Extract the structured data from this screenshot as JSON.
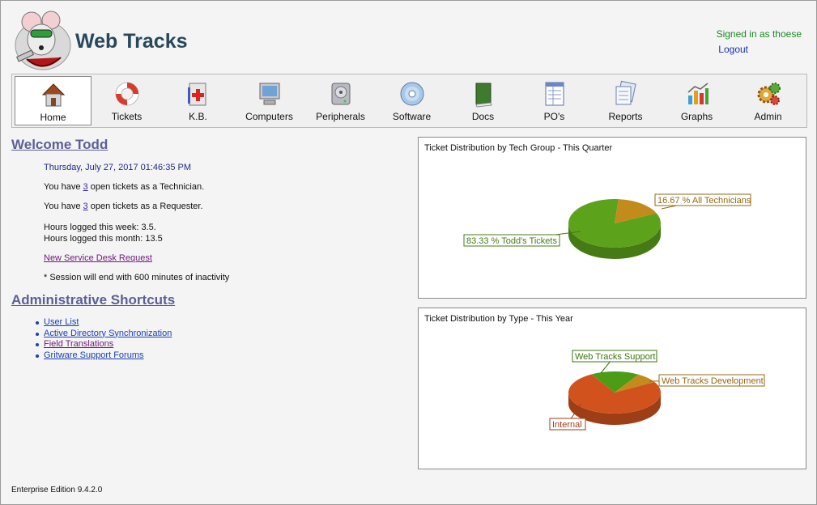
{
  "header": {
    "app_title": "Web Tracks",
    "signed_in": "Signed in as thoese",
    "logout": "Logout"
  },
  "nav": [
    {
      "label": "Home",
      "icon": "home-icon",
      "active": true
    },
    {
      "label": "Tickets",
      "icon": "lifebuoy-icon"
    },
    {
      "label": "K.B.",
      "icon": "first-aid-kit-icon"
    },
    {
      "label": "Computers",
      "icon": "monitor-icon"
    },
    {
      "label": "Peripherals",
      "icon": "hard-drive-icon"
    },
    {
      "label": "Software",
      "icon": "cd-icon"
    },
    {
      "label": "Docs",
      "icon": "book-icon"
    },
    {
      "label": "PO's",
      "icon": "form-icon"
    },
    {
      "label": "Reports",
      "icon": "reports-icon"
    },
    {
      "label": "Graphs",
      "icon": "bar-graph-icon"
    },
    {
      "label": "Admin",
      "icon": "gears-icon"
    }
  ],
  "welcome": {
    "title": "Welcome Todd",
    "date": "Thursday, July 27, 2017 01:46:35 PM",
    "tech_prefix": "You have ",
    "tech_count": "3",
    "tech_suffix": " open tickets as a Technician.",
    "req_prefix": "You have ",
    "req_count": "3",
    "req_suffix": " open tickets as a Requester.",
    "hours_week": "Hours logged this week: 3.5.",
    "hours_month": "Hours logged this month: 13.5",
    "new_request": "New Service Desk Request",
    "session_note": "* Session will end with 600 minutes of inactivity"
  },
  "shortcuts": {
    "title": "Administrative Shortcuts",
    "items": [
      {
        "label": "User List"
      },
      {
        "label": "Active Directory Synchronization"
      },
      {
        "label": "Field Translations"
      },
      {
        "label": "Gritware Support Forums"
      }
    ]
  },
  "chart_data": [
    {
      "type": "pie",
      "title": "Ticket Distribution by Tech Group - This Quarter",
      "slices": [
        {
          "label": "83.33 % Todd's Tickets",
          "value": 83.33,
          "color": "#5da21b"
        },
        {
          "label": "16.67 % All Technicians",
          "value": 16.67,
          "color": "#c38b1c"
        }
      ]
    },
    {
      "type": "pie",
      "title": "Ticket Distribution by Type - This Year",
      "slices": [
        {
          "label": "Web Tracks Support",
          "value": 17,
          "color": "#4d9c16"
        },
        {
          "label": "Web Tracks Development",
          "value": 8,
          "color": "#c38b1c"
        },
        {
          "label": "Internal",
          "value": 75,
          "color": "#d2521e"
        }
      ]
    }
  ],
  "footer": {
    "edition": "Enterprise Edition 9.4.2.0"
  }
}
